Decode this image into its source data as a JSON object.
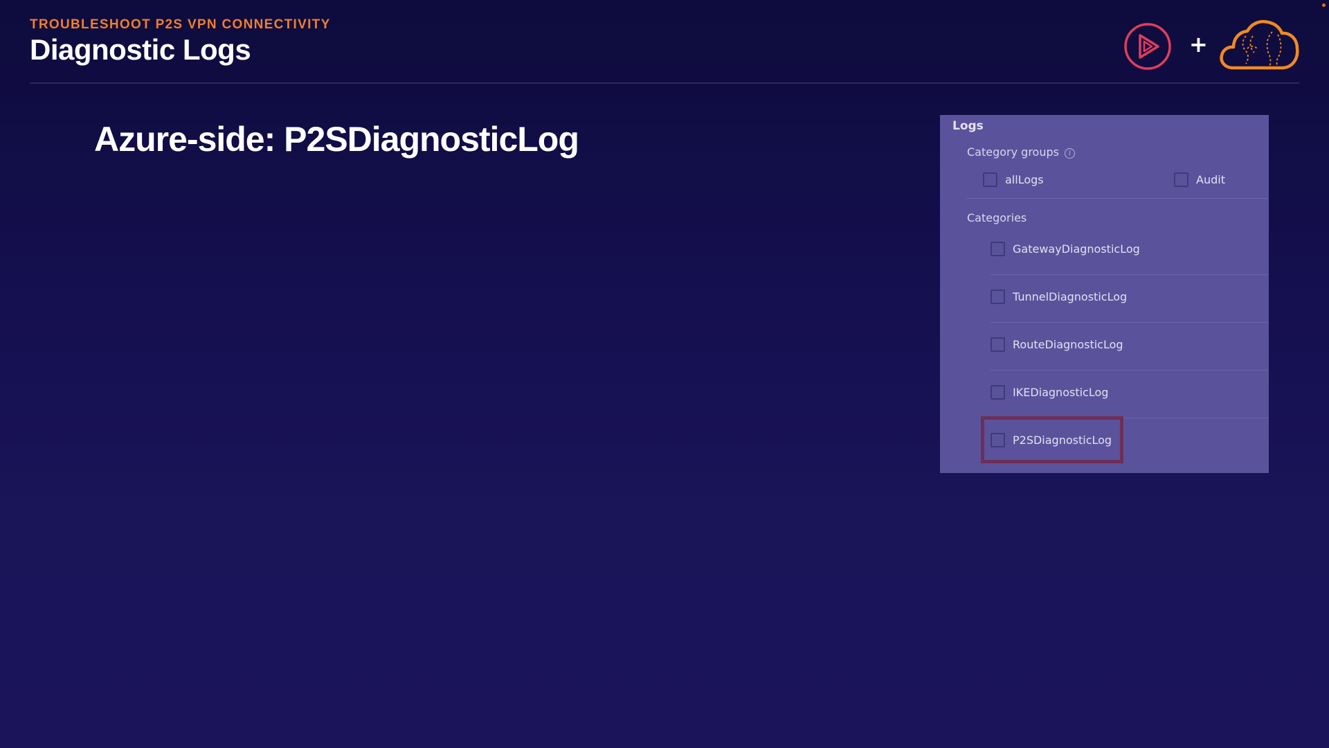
{
  "header": {
    "kicker": "TROUBLESHOOT P2S VPN CONNECTIVITY",
    "title": "Diagnostic Logs"
  },
  "slide": {
    "heading": "Azure-side: P2SDiagnosticLog"
  },
  "logos": {
    "left_icon": "play-icon",
    "separator": "+",
    "right_icon": "cloud-icon",
    "colors": {
      "play": "#e23d5a",
      "cloud": "#f08a24"
    }
  },
  "logs_panel": {
    "heading": "Logs",
    "category_groups": {
      "label": "Category groups",
      "info_icon": "i",
      "options": [
        {
          "label": "allLogs",
          "checked": false
        },
        {
          "label": "Audit",
          "checked": false
        }
      ]
    },
    "categories": {
      "label": "Categories",
      "items": [
        {
          "label": "GatewayDiagnosticLog",
          "checked": false
        },
        {
          "label": "TunnelDiagnosticLog",
          "checked": false
        },
        {
          "label": "RouteDiagnosticLog",
          "checked": false
        },
        {
          "label": "IKEDiagnosticLog",
          "checked": false
        },
        {
          "label": "P2SDiagnosticLog",
          "checked": false,
          "highlighted": true
        }
      ]
    },
    "highlight_color": "#6e2e57"
  },
  "colors": {
    "accent": "#f07f2a",
    "background": "#140f4d",
    "panel": "#5a539b"
  }
}
